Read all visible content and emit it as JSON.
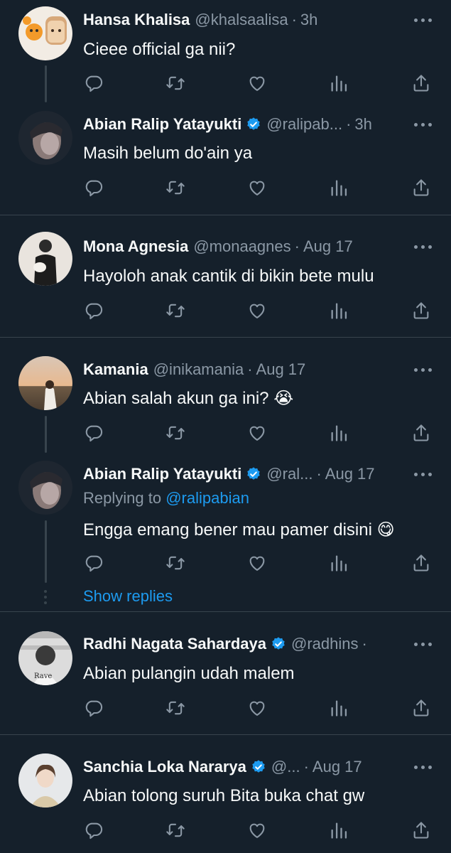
{
  "tweets": [
    {
      "name": "Hansa Khalisa",
      "handle": "@khalsaalisa",
      "time": "3h",
      "verified": false,
      "text": "Cieee official ga nii?"
    },
    {
      "name": "Abian Ralip Yatayukti",
      "handle": "@ralipab...",
      "time": "3h",
      "verified": true,
      "text": "Masih belum do'ain ya"
    },
    {
      "name": "Mona Agnesia",
      "handle": "@monaagnes",
      "time": "Aug 17",
      "verified": false,
      "text": "Hayoloh anak cantik di bikin bete mulu"
    },
    {
      "name": "Kamania",
      "handle": "@inikamania",
      "time": "Aug 17",
      "verified": false,
      "text": "Abian salah akun ga ini? 😭"
    },
    {
      "name": "Abian Ralip Yatayukti",
      "handle": "@ral...",
      "time": "Aug 17",
      "verified": true,
      "replying_label": "Replying to",
      "replying_to": "@ralipabian",
      "text": "Engga emang bener mau pamer disini 😋"
    },
    {
      "name": "Radhi Nagata Sahardaya",
      "handle": "@radhins",
      "time": "",
      "verified": true,
      "text": "Abian pulangin udah malem"
    },
    {
      "name": "Sanchia Loka Nararya",
      "handle": "@...",
      "time": "Aug 17",
      "verified": true,
      "text": "Abian tolong suruh Bita buka chat gw"
    }
  ],
  "show_replies": "Show replies",
  "colors": {
    "background": "#15202b",
    "text": "#f7f9f9",
    "secondary": "#8b98a5",
    "accent": "#1d9bf0",
    "divider": "#38444d"
  }
}
